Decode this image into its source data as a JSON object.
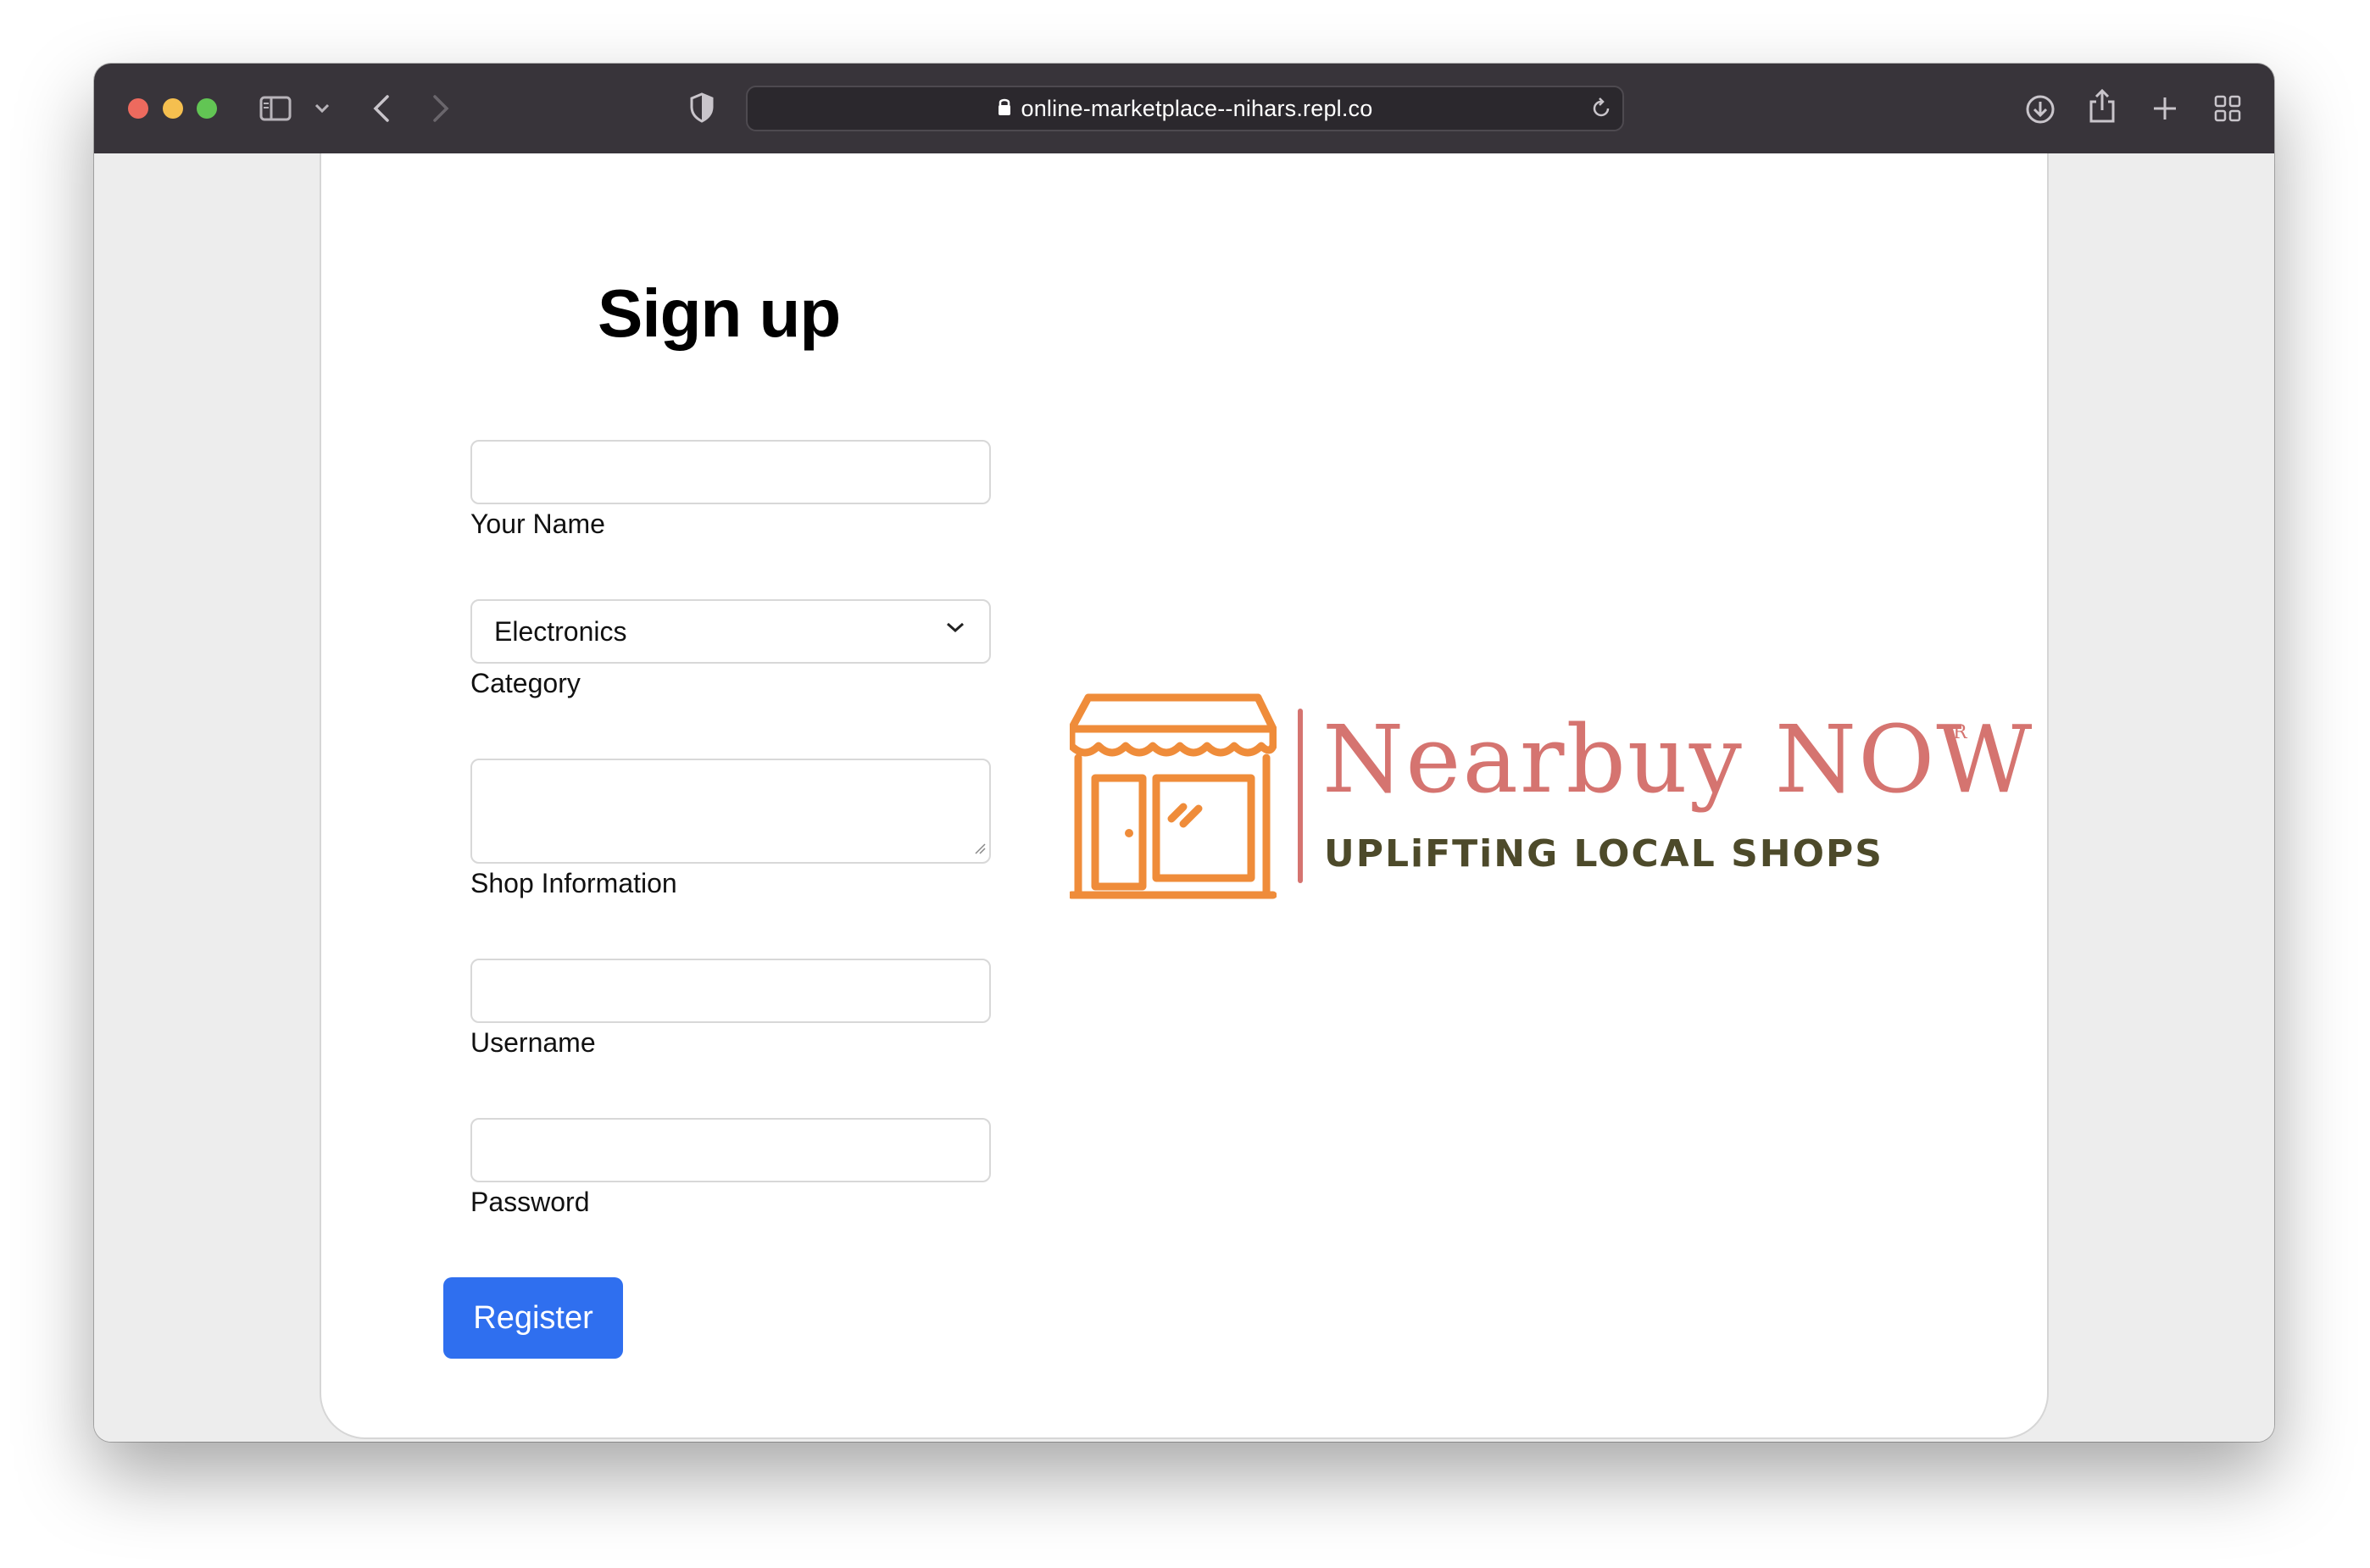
{
  "browser": {
    "url": "online-marketplace--nihars.repl.co",
    "colors": {
      "close": "#ed6a5e",
      "minimize": "#f5bf4f",
      "zoom": "#62c554",
      "toolbar": "#38343a"
    },
    "icons": [
      "sidebar-icon",
      "chevron-down-icon",
      "back-arrow-icon",
      "forward-arrow-icon",
      "shield-icon",
      "lock-icon",
      "reload-icon",
      "download-icon",
      "share-icon",
      "new-tab-icon",
      "tab-overview-icon"
    ]
  },
  "form": {
    "title": "Sign up",
    "fields": [
      {
        "label": "Your Name",
        "value": ""
      },
      {
        "label": "Category",
        "value": "Electronics"
      },
      {
        "label": "Shop Information",
        "value": ""
      },
      {
        "label": "Username",
        "value": ""
      },
      {
        "label": "Password",
        "value": ""
      }
    ],
    "register_label": "Register",
    "register_color": "#2f6fef"
  },
  "logo": {
    "brand": "Nearbuy NOW",
    "registered_mark": "R",
    "tagline": "UPLiFTiNG LOCAL SHOPS",
    "brand_color": "#d57470",
    "icon_color": "#ef8c3a",
    "tagline_color": "#4d4a2a"
  }
}
